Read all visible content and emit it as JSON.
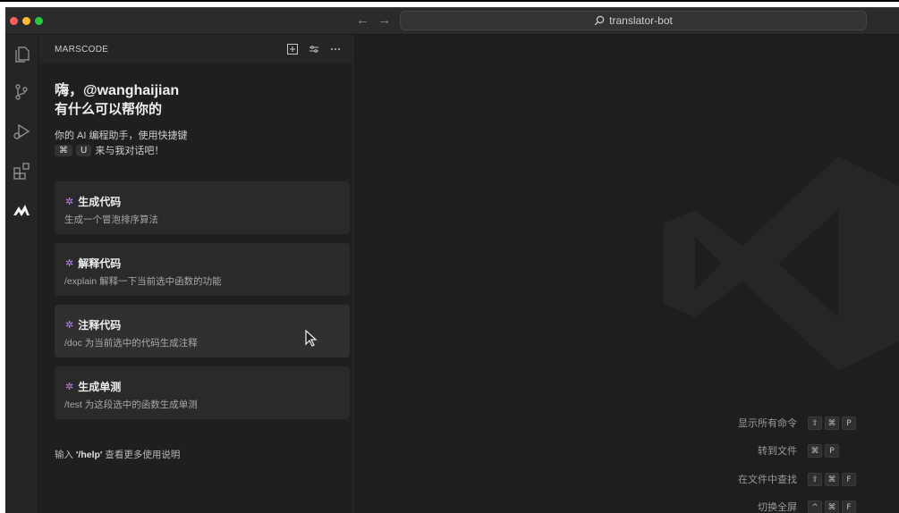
{
  "window": {
    "title": "translator-bot",
    "traffic_colors": [
      "#ff5f57",
      "#febc2e",
      "#28c840"
    ],
    "nav_back": "←",
    "nav_forward": "→"
  },
  "activity_bar": {
    "items": [
      "explorer-icon",
      "source-control-icon",
      "run-debug-icon",
      "extensions-icon",
      "marscode-icon"
    ]
  },
  "panel": {
    "title": "MARSCODE",
    "greeting_line1": "嗨，@wanghaijian",
    "greeting_line2": "有什么可以帮你的",
    "description_line1": "你的 AI 编程助手，使用快捷键",
    "shortcut_key1": "⌘",
    "shortcut_key2": "U",
    "description_line2": "来与我对话吧！",
    "cards": [
      {
        "title": "生成代码",
        "subtitle": "生成一个冒泡排序算法"
      },
      {
        "title": "解释代码",
        "subtitle": "/explain 解释一下当前选中函数的功能"
      },
      {
        "title": "注释代码",
        "subtitle": "/doc 为当前选中的代码生成注释"
      },
      {
        "title": "生成单测",
        "subtitle": "/test 为这段选中的函数生成单测"
      }
    ],
    "help_prefix": "输入 ",
    "help_command": "'/help'",
    "help_suffix": " 查看更多使用说明"
  },
  "editor": {
    "shortcuts": [
      {
        "label": "显示所有命令",
        "keys": [
          "⇧",
          "⌘",
          "P"
        ]
      },
      {
        "label": "转到文件",
        "keys": [
          "⌘",
          "P"
        ]
      },
      {
        "label": "在文件中查找",
        "keys": [
          "⇧",
          "⌘",
          "F"
        ]
      },
      {
        "label": "切换全屏",
        "keys": [
          "^",
          "⌘",
          "F"
        ]
      }
    ]
  },
  "colors": {
    "accent_spark": "#c77dff",
    "background": "#1e1e1e",
    "panel": "#1f1f1f"
  }
}
